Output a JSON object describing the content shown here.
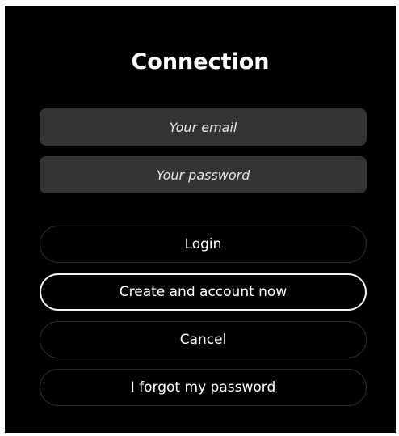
{
  "dialog": {
    "title": "Connection",
    "email": {
      "value": "",
      "placeholder": "Your email"
    },
    "password": {
      "value": "",
      "placeholder": "Your password"
    },
    "buttons": {
      "login": "Login",
      "create_account": "Create and account now",
      "cancel": "Cancel",
      "forgot_password": "I forgot my password"
    },
    "focused_button": "create_account"
  },
  "colors": {
    "background": "#000000",
    "field_background": "#333333",
    "button_border": "#2c2c2c",
    "focused_border": "#f2f2f2",
    "text": "#ffffff"
  }
}
